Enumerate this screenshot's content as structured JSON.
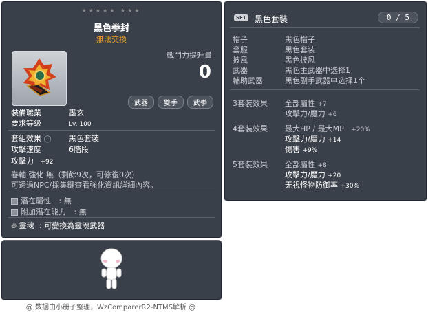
{
  "item_id": "01403023",
  "item": {
    "stars": "★★★★★  ★★★",
    "name": "黑色拳封",
    "trade": "無法交換",
    "power_label": "戰鬥力提升量",
    "power_value": "0",
    "tags": [
      "武器",
      "雙手",
      "武拳"
    ],
    "job_label": "裝備職業",
    "job_value": "墨玄",
    "level_label": "要求等级",
    "level_value": "Lv. 100",
    "set_label": "套組效果",
    "set_value": "黑色套裝",
    "speed_label": "攻擊速度",
    "speed_value": "6階段",
    "attack_label": "攻擊力",
    "attack_value": "+92",
    "scroll_text": "卷軸 強化 無（剩餘9次，可修復0次）",
    "npc_text": "可透過NPC/採集鍵查看強化資訊詳細內容。",
    "potential_label": "潛在屬性",
    "potential_value": ": 無",
    "bonus_potential_label": "附加潛在能力",
    "bonus_potential_value": ": 無",
    "soul_label": "靈魂",
    "soul_value": ": 可變換為靈魂武器"
  },
  "set_panel": {
    "badge": "SET",
    "name": "黑色套裝",
    "count": "0 / 5",
    "parts": [
      {
        "k": "帽子",
        "v": "黑色帽子"
      },
      {
        "k": "套服",
        "v": "黑色套装"
      },
      {
        "k": "披風",
        "v": "黑色披风"
      },
      {
        "k": "武器",
        "v": "黑色主武器中选择1"
      },
      {
        "k": "輔助武器",
        "v": "黑色副手武器中选择1个"
      }
    ],
    "effects": [
      {
        "title": "3套裝效果",
        "lines": [
          [
            "全部屬性",
            "+7"
          ],
          [
            "攻擊力/魔力",
            "+6"
          ]
        ]
      },
      {
        "title": "4套裝效果",
        "lines": [
          [
            "最大HP / 最大MP",
            "+20%"
          ],
          [
            "攻擊力/魔力",
            "+14"
          ],
          [
            "傷害",
            "+9%"
          ]
        ]
      },
      {
        "title": "5套裝效果",
        "lines": [
          [
            "全部屬性",
            "+8"
          ],
          [
            "攻擊力/魔力",
            "+20"
          ],
          [
            "无視怪物防御率",
            "+30%"
          ]
        ]
      }
    ]
  },
  "footer": "@ 数据由小册子整理，WzComparerR2-NTMS解析 @"
}
